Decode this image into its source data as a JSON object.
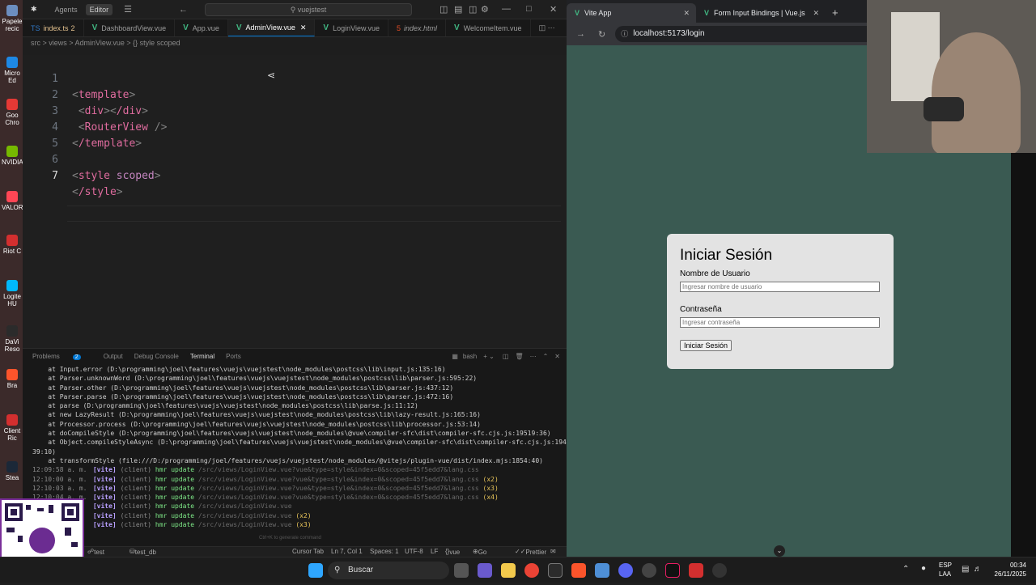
{
  "desktop": {
    "items": [
      {
        "label": "Papele recic",
        "color": "#6c8ebf"
      },
      {
        "label": "Micro Ed",
        "color": "#1e88e5"
      },
      {
        "label": "Goo Chro",
        "color": "#e53935"
      },
      {
        "label": "NVIDIA",
        "color": "#76b900"
      },
      {
        "label": "VALOR",
        "color": "#ff4655"
      },
      {
        "label": "Riot C",
        "color": "#d32f2f"
      },
      {
        "label": "Logite HU",
        "color": "#00b8fc"
      },
      {
        "label": "DaVi Reso",
        "color": "#2b2b2b"
      },
      {
        "label": "Bra",
        "color": "#fb542b"
      },
      {
        "label": "Client Ric",
        "color": "#d32f2f"
      },
      {
        "label": "Stea",
        "color": "#1b2838"
      }
    ]
  },
  "vscode": {
    "titlebar": {
      "agents": "Agents",
      "editor": "Editor",
      "search": "vuejstest"
    },
    "tabs": [
      {
        "label": "index.ts",
        "suffix": "2",
        "kind": "ts"
      },
      {
        "label": "DashboardView.vue",
        "kind": "vue"
      },
      {
        "label": "App.vue",
        "kind": "vue"
      },
      {
        "label": "AdminView.vue",
        "kind": "vue",
        "active": true
      },
      {
        "label": "LoginView.vue",
        "kind": "vue"
      },
      {
        "label": "index.html",
        "kind": "html"
      },
      {
        "label": "WelcomeItem.vue",
        "kind": "vue"
      }
    ],
    "breadcrumb": "src > views > AdminView.vue > {} style scoped",
    "code_lines": [
      {
        "n": "1"
      },
      {
        "n": "2"
      },
      {
        "n": "3"
      },
      {
        "n": "4"
      },
      {
        "n": "5"
      },
      {
        "n": "6"
      },
      {
        "n": "7"
      }
    ],
    "code": {
      "l1": "template",
      "l2a": "div",
      "l2b": "/div",
      "l3": "RouterView",
      "l4": "/template",
      "l6a": "style",
      "l6b": "scoped",
      "l7": "/style"
    },
    "panel": {
      "problems": "Problems",
      "problems_count": "2",
      "output": "Output",
      "debug": "Debug Console",
      "terminal": "Terminal",
      "ports": "Ports",
      "shell": "bash"
    },
    "terminal_stack": [
      "    at Input.error (D:\\programming\\joel\\features\\vuejs\\vuejstest\\node_modules\\postcss\\lib\\input.js:135:16)",
      "    at Parser.unknownWord (D:\\programming\\joel\\features\\vuejs\\vuejstest\\node_modules\\postcss\\lib\\parser.js:595:22)",
      "    at Parser.other (D:\\programming\\joel\\features\\vuejs\\vuejstest\\node_modules\\postcss\\lib\\parser.js:437:12)",
      "    at Parser.parse (D:\\programming\\joel\\features\\vuejs\\vuejstest\\node_modules\\postcss\\lib\\parser.js:472:16)",
      "    at parse (D:\\programming\\joel\\features\\vuejs\\vuejstest\\node_modules\\postcss\\lib\\parse.js:11:12)",
      "    at new LazyResult (D:\\programming\\joel\\features\\vuejs\\vuejstest\\node_modules\\postcss\\lib\\lazy-result.js:165:16)",
      "    at Processor.process (D:\\programming\\joel\\features\\vuejs\\vuejstest\\node_modules\\postcss\\lib\\processor.js:53:14)",
      "    at doCompileStyle (D:\\programming\\joel\\features\\vuejs\\vuejstest\\node_modules\\@vue\\compiler-sfc\\dist\\compiler-sfc.cjs.js:19519:36)",
      "    at Object.compileStyleAsync (D:\\programming\\joel\\features\\vuejs\\vuejstest\\node_modules\\@vue\\compiler-sfc\\dist\\compiler-sfc.cjs.js:194",
      "39:10)",
      "    at transformStyle (file:///D:/programming/joel/features/vuejs/vuejstest/node_modules/@vitejs/plugin-vue/dist/index.mjs:1854:40)"
    ],
    "terminal_hmr": [
      {
        "ts": "12:09:58 a. m.",
        "path": "/src/views/LoginView.vue?vue&type=style&index=0&scoped=45f5edd7&lang.css",
        "count": ""
      },
      {
        "ts": "12:10:00 a. m.",
        "path": "/src/views/LoginView.vue?vue&type=style&index=0&scoped=45f5edd7&lang.css",
        "count": "(x2)"
      },
      {
        "ts": "12:10:03 a. m.",
        "path": "/src/views/LoginView.vue?vue&type=style&index=0&scoped=45f5edd7&lang.css",
        "count": "(x3)"
      },
      {
        "ts": "12:10:04 a. m.",
        "path": "/src/views/LoginView.vue?vue&type=style&index=0&scoped=45f5edd7&lang.css",
        "count": "(x4)"
      },
      {
        "ts": "",
        "path": "/src/views/LoginView.vue",
        "count": ""
      },
      {
        "ts": "",
        "path": "/src/views/LoginView.vue",
        "count": "(x2)"
      },
      {
        "ts": "",
        "path": "/src/views/LoginView.vue",
        "count": "(x3)"
      }
    ],
    "terminal_tokens": {
      "vite": "[vite]",
      "client": "(client)",
      "hmr": "hmr update"
    },
    "terminal_hint": "Ctrl+K to generate command",
    "status": {
      "connect": "test connect",
      "db": "test_db",
      "cursor_tab": "Cursor Tab",
      "position": "Ln 7, Col 1",
      "spaces": "Spaces: 1",
      "encoding": "UTF-8",
      "eol": "LF",
      "lang": "vue",
      "golive": "Go Live",
      "prettier": "Prettier"
    }
  },
  "browser": {
    "tabs": [
      {
        "label": "Vite App",
        "active": true
      },
      {
        "label": "Form Input Bindings | Vue.js",
        "active": false
      }
    ],
    "url": "localhost:5173/login",
    "login": {
      "title": "Iniciar Sesión",
      "user_label": "Nombre de Usuario",
      "user_placeholder": "Ingresar nombre de usuario",
      "pass_label": "Contraseña",
      "pass_placeholder": "Ingresar contraseña",
      "submit": "Iniciar Sesión"
    }
  },
  "taskbar": {
    "search": "Buscar",
    "lang1": "ESP",
    "lang2": "LAA",
    "time": "00:34",
    "date": "26/11/2025"
  }
}
